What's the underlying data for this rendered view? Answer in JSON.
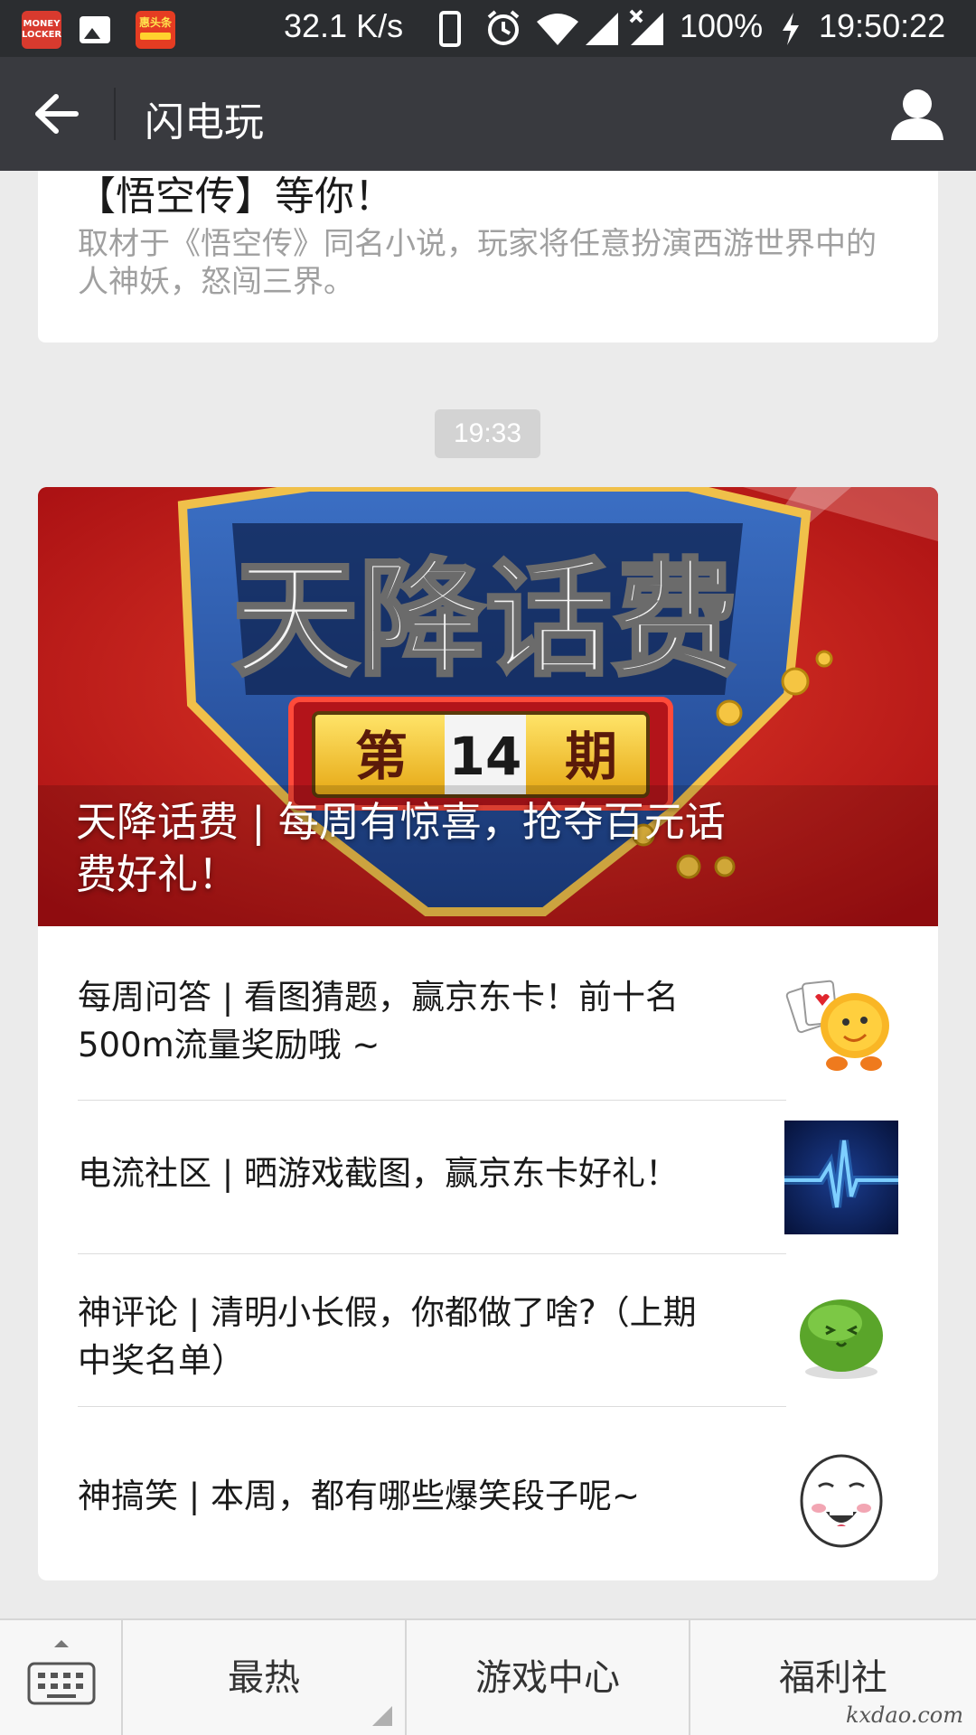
{
  "status_bar": {
    "app1_label": "MONEY LOCKER",
    "app3_label": "惠头条",
    "speed": "32.1 K/s",
    "battery": "100%",
    "time": "19:50:22"
  },
  "nav": {
    "title": "闪电玩"
  },
  "previous_article": {
    "title_fragment": "【悟空传】等你！",
    "description": "取材于《悟空传》同名小说，玩家将任意扮演西游世界中的人神妖，怒闯三界。"
  },
  "timestamp": "19:33",
  "news": {
    "hero_caption": "天降话费 | 每周有惊喜，抢夺百元话费好礼！",
    "hero_art": {
      "title_text": "天降话费",
      "issue_left": "第",
      "issue_number": "14",
      "issue_right": "期"
    },
    "items": [
      {
        "title": "每周问答 | 看图猜题，赢京东卡！前十名500m流量奖励哦 ~",
        "thumb": "poker-mascot-icon"
      },
      {
        "title": "电流社区 | 晒游戏截图，赢京东卡好礼！",
        "thumb": "pulse-wave-icon"
      },
      {
        "title": "神评论 | 清明小长假，你都做了啥?（上期中奖名单）",
        "thumb": "green-blob-icon"
      },
      {
        "title": "神搞笑 | 本周，都有哪些爆笑段子呢~",
        "thumb": "laughing-face-icon"
      }
    ]
  },
  "bottom_menu": {
    "tabs": [
      "最热",
      "游戏中心",
      "福利社"
    ],
    "watermark": "kxdao.com"
  },
  "colors": {
    "status_bar": "#2b2d30",
    "nav_bar": "#393a3f",
    "background": "#ebebeb",
    "hero_red": "#c51a1a"
  }
}
